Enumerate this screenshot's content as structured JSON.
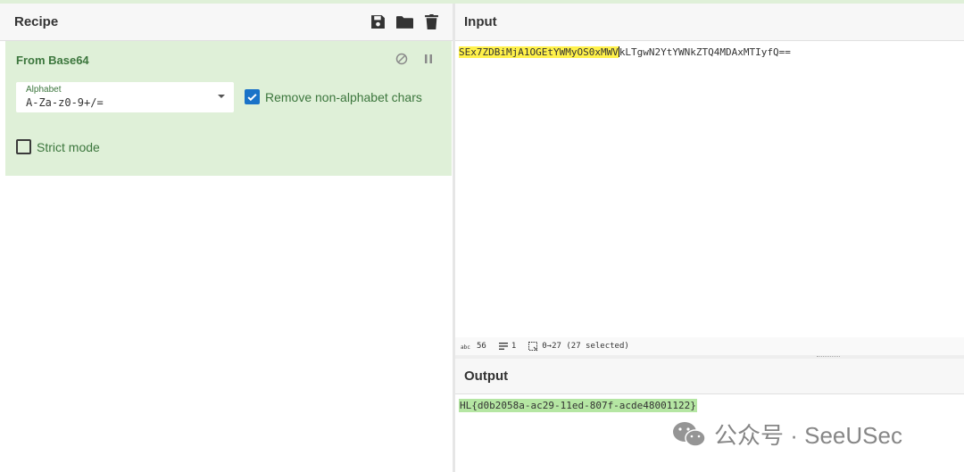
{
  "recipe": {
    "title": "Recipe",
    "icons": [
      "save-icon",
      "folder-icon",
      "trash-icon"
    ],
    "operation": {
      "name": "From Base64",
      "controls": [
        "disable-icon",
        "pause-icon"
      ],
      "alphabet_label": "Alphabet",
      "alphabet_value": "A-Za-z0-9+/=",
      "remove_non_alphabet_label": "Remove non-alphabet chars",
      "remove_non_alphabet_checked": true,
      "strict_mode_label": "Strict mode",
      "strict_mode_checked": false
    }
  },
  "input": {
    "title": "Input",
    "text_selected": "SEx7ZDBiMjA1OGEtYWMyOS0xMWV",
    "text_rest": "kLTgwN2YtYWNkZTQ4MDAxMTIyfQ==",
    "status": {
      "length_label": "56",
      "lines_label": "1",
      "selection_label": "0→27 (27 selected)"
    }
  },
  "output": {
    "title": "Output",
    "text": "HL{d0b2058a-ac29-11ed-807f-acde48001122}"
  },
  "watermark": {
    "text": "公众号 · SeeUSec"
  },
  "colors": {
    "operation_bg": "#dff0d8",
    "operation_text": "#3c763d",
    "selection_highlight": "#fff14a",
    "output_highlight": "#b5e6a3",
    "checkbox_checked": "#1a73c8"
  }
}
